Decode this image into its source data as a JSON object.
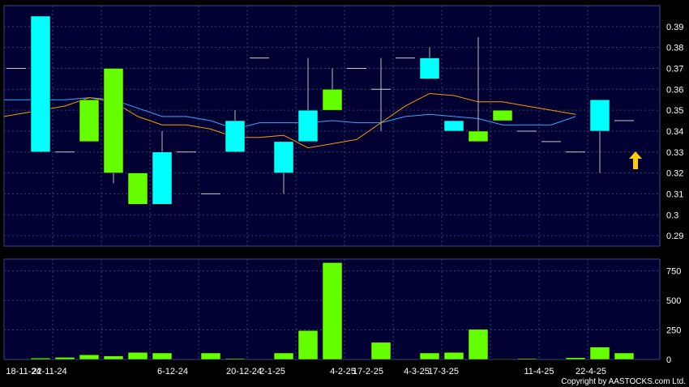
{
  "chart_data": [
    {
      "type": "candlestick",
      "title": "",
      "ylim": [
        0.285,
        0.4
      ],
      "yticks": [
        "0.29",
        "0.3",
        "0.31",
        "0.32",
        "0.33",
        "0.34",
        "0.35",
        "0.36",
        "0.37",
        "0.38",
        "0.39"
      ],
      "grid": true,
      "candles": [
        {
          "o": 0.37,
          "h": 0.37,
          "l": 0.37,
          "c": 0.37
        },
        {
          "o": 0.33,
          "h": 0.395,
          "l": 0.33,
          "c": 0.395
        },
        {
          "o": 0.33,
          "h": 0.33,
          "l": 0.33,
          "c": 0.33
        },
        {
          "o": 0.355,
          "h": 0.355,
          "l": 0.335,
          "c": 0.335
        },
        {
          "o": 0.37,
          "h": 0.37,
          "l": 0.315,
          "c": 0.32
        },
        {
          "o": 0.32,
          "h": 0.32,
          "l": 0.305,
          "c": 0.305
        },
        {
          "o": 0.305,
          "h": 0.34,
          "l": 0.305,
          "c": 0.33
        },
        {
          "o": 0.33,
          "h": 0.33,
          "l": 0.33,
          "c": 0.33
        },
        {
          "o": 0.31,
          "h": 0.31,
          "l": 0.31,
          "c": 0.31
        },
        {
          "o": 0.33,
          "h": 0.35,
          "l": 0.33,
          "c": 0.345
        },
        {
          "o": 0.375,
          "h": 0.375,
          "l": 0.375,
          "c": 0.375
        },
        {
          "o": 0.32,
          "h": 0.335,
          "l": 0.31,
          "c": 0.335
        },
        {
          "o": 0.335,
          "h": 0.375,
          "l": 0.335,
          "c": 0.35
        },
        {
          "o": 0.36,
          "h": 0.37,
          "l": 0.35,
          "c": 0.35
        },
        {
          "o": 0.37,
          "h": 0.37,
          "l": 0.37,
          "c": 0.37
        },
        {
          "o": 0.36,
          "h": 0.375,
          "l": 0.34,
          "c": 0.36
        },
        {
          "o": 0.375,
          "h": 0.375,
          "l": 0.375,
          "c": 0.375
        },
        {
          "o": 0.365,
          "h": 0.38,
          "l": 0.365,
          "c": 0.375
        },
        {
          "o": 0.34,
          "h": 0.345,
          "l": 0.34,
          "c": 0.345
        },
        {
          "o": 0.34,
          "h": 0.385,
          "l": 0.335,
          "c": 0.335
        },
        {
          "o": 0.35,
          "h": 0.35,
          "l": 0.345,
          "c": 0.345
        },
        {
          "o": 0.34,
          "h": 0.34,
          "l": 0.34,
          "c": 0.34
        },
        {
          "o": 0.335,
          "h": 0.335,
          "l": 0.335,
          "c": 0.335
        },
        {
          "o": 0.33,
          "h": 0.33,
          "l": 0.33,
          "c": 0.33
        },
        {
          "o": 0.34,
          "h": 0.355,
          "l": 0.32,
          "c": 0.355
        },
        {
          "o": 0.345,
          "h": 0.345,
          "l": 0.345,
          "c": 0.345
        }
      ],
      "ma_fast": [
        0.347,
        0.352,
        0.356,
        0.354,
        0.347,
        0.343,
        0.343,
        0.341,
        0.337,
        0.337,
        0.338,
        0.332,
        0.334,
        0.336,
        0.344,
        0.352,
        0.358,
        0.357,
        0.354,
        0.354,
        0.352,
        0.35,
        0.348
      ],
      "ma_slow": [
        0.355,
        0.355,
        0.356,
        0.355,
        0.351,
        0.347,
        0.347,
        0.345,
        0.341,
        0.344,
        0.344,
        0.344,
        0.345,
        0.344,
        0.344,
        0.347,
        0.348,
        0.347,
        0.346,
        0.343,
        0.343,
        0.343,
        0.347
      ],
      "colors": {
        "up": "#00ffff",
        "down": "#66ff00",
        "ma_fast": "#ff9900",
        "ma_slow": "#33aaff",
        "grid": "#2f3f78",
        "background": "#000033"
      }
    },
    {
      "type": "bar",
      "ylim": [
        0,
        850
      ],
      "yticks": [
        "0",
        "250",
        "500",
        "750"
      ],
      "values": [
        0,
        12,
        18,
        40,
        30,
        60,
        55,
        0,
        55,
        8,
        0,
        55,
        245,
        820,
        0,
        145,
        0,
        55,
        60,
        255,
        5,
        8,
        0,
        15,
        105,
        55
      ],
      "colors": {
        "bar": "#66ff00"
      }
    }
  ],
  "x_ticks": [
    "18-11-24",
    "22-11-24",
    "6-12-24",
    "20-12-24",
    "2-1-25",
    "4-2-25",
    "17-2-25",
    "4-3-25",
    "17-3-25",
    "11-4-25",
    "22-4-25"
  ],
  "indicator": {
    "icon": "up-arrow-icon",
    "color": "#ffcc00"
  },
  "copyright": "Copyright by AASTOCKS.com Ltd."
}
